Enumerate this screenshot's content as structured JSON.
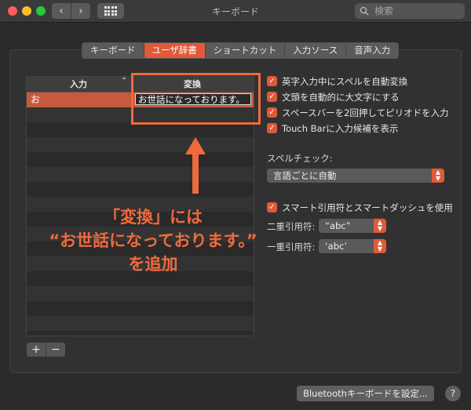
{
  "window": {
    "title": "キーボード",
    "search_placeholder": "検索",
    "back_icon": "‹",
    "forward_icon": "›"
  },
  "tabs": [
    {
      "label": "キーボード",
      "active": false
    },
    {
      "label": "ユーザ辞書",
      "active": true
    },
    {
      "label": "ショートカット",
      "active": false
    },
    {
      "label": "入力ソース",
      "active": false
    },
    {
      "label": "音声入力",
      "active": false
    }
  ],
  "table": {
    "col_input": "入力",
    "col_conversion": "変換",
    "rows": [
      {
        "input": "お",
        "conversion": "お世話になっております。",
        "selected": true
      }
    ]
  },
  "buttons": {
    "add": "+",
    "remove": "−",
    "bluetooth": "Bluetoothキーボードを設定...",
    "help": "?"
  },
  "options": [
    {
      "label": "英字入力中にスペルを自動変換",
      "checked": true
    },
    {
      "label": "文頭を自動的に大文字にする",
      "checked": true
    },
    {
      "label": "スペースバーを2回押してピリオドを入力",
      "checked": true
    },
    {
      "label": "Touch Barに入力候補を表示",
      "checked": true
    }
  ],
  "spell_check": {
    "label": "スペルチェック:",
    "value": "言語ごとに自動"
  },
  "smart_quotes": {
    "label": "スマート引用符とスマートダッシュを使用",
    "checked": true,
    "double_label": "二重引用符:",
    "double_value": "“abc”",
    "single_label": "一重引用符:",
    "single_value": "‘abc’"
  },
  "annotation": {
    "line1": "「変換」には",
    "line2": "“お世話になっております。”",
    "line3": "を追加",
    "color": "#f06a3c"
  }
}
